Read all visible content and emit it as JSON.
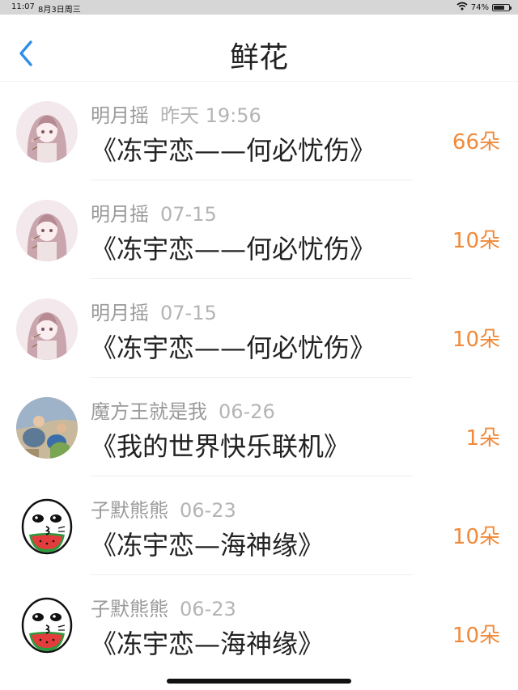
{
  "status_bar": {
    "time": "11:07",
    "date": "8月3日周三",
    "battery": "74%",
    "battery_level": 0.74
  },
  "header": {
    "title": "鲜花",
    "back_icon": "chevron-left-icon"
  },
  "colors": {
    "accent_blue": "#2f8fe8",
    "count_orange": "#f08a3a"
  },
  "records": [
    {
      "user": "明月摇",
      "time": "昨天 19:56",
      "title": "《冻宇恋——何必忧伤》",
      "count": "66朵",
      "avatar": "anime-girl-avatar"
    },
    {
      "user": "明月摇",
      "time": "07-15",
      "title": "《冻宇恋——何必忧伤》",
      "count": "10朵",
      "avatar": "anime-girl-avatar"
    },
    {
      "user": "明月摇",
      "time": "07-15",
      "title": "《冻宇恋——何必忧伤》",
      "count": "10朵",
      "avatar": "anime-girl-avatar"
    },
    {
      "user": "魔方王就是我",
      "time": "06-26",
      "title": "《我的世界快乐联机》",
      "count": "1朵",
      "avatar": "photo-avatar"
    },
    {
      "user": "子默熊熊",
      "time": "06-23",
      "title": "《冻宇恋—海神缘》",
      "count": "10朵",
      "avatar": "watermelon-face-avatar"
    },
    {
      "user": "子默熊熊",
      "time": "06-23",
      "title": "《冻宇恋—海神缘》",
      "count": "10朵",
      "avatar": "watermelon-face-avatar"
    }
  ]
}
